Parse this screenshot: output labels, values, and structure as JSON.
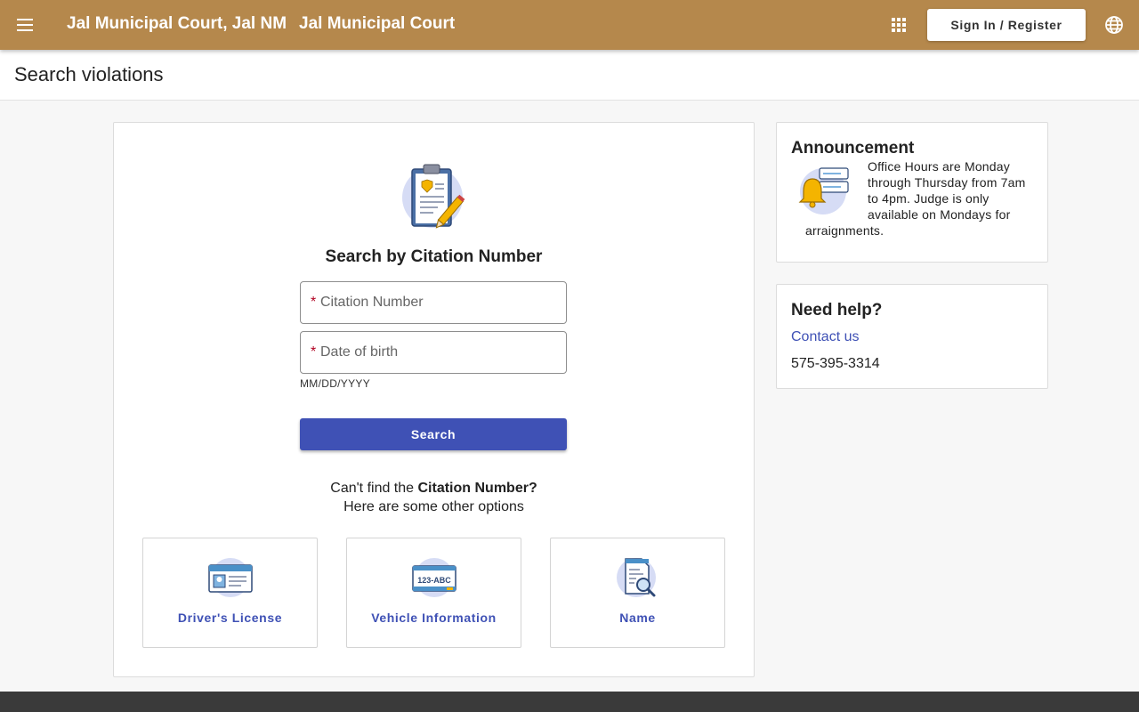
{
  "app": {
    "brand": "Jal Municipal Court, Jal NM",
    "brand_sub": "Jal Municipal Court",
    "menu_icon": "hamburger-menu-icon",
    "apps_icon": "apps-grid-icon",
    "signin_label": "Sign In / Register",
    "language_icon": "globe-icon",
    "header_color": "#b5884c"
  },
  "page": {
    "title": "Search violations"
  },
  "search": {
    "heading": "Search by Citation Number",
    "citation_required_mark": "*",
    "citation_label": "Citation Number",
    "dob_required_mark": "*",
    "dob_label": "Date of birth",
    "dob_hint": "MM/DD/YYYY",
    "button_label": "Search",
    "accent": "#3f51b5"
  },
  "options": {
    "line1_prefix": "Can't find the ",
    "line1_bold": "Citation Number?",
    "line2": "Here are some other options",
    "items": [
      {
        "label": "Driver's License",
        "icon": "drivers-license-icon"
      },
      {
        "label": "Vehicle Information",
        "icon": "license-plate-icon",
        "plate_text": "123-ABC"
      },
      {
        "label": "Name",
        "icon": "name-search-icon"
      }
    ]
  },
  "announcement": {
    "title": "Announcement",
    "icon": "bell-icon",
    "text": "Office Hours are Monday through Thursday from 7am to 4pm. Judge is only available on Mondays for arraignments."
  },
  "help": {
    "title": "Need help?",
    "contact_label": "Contact us",
    "phone": "575-395-3314"
  }
}
